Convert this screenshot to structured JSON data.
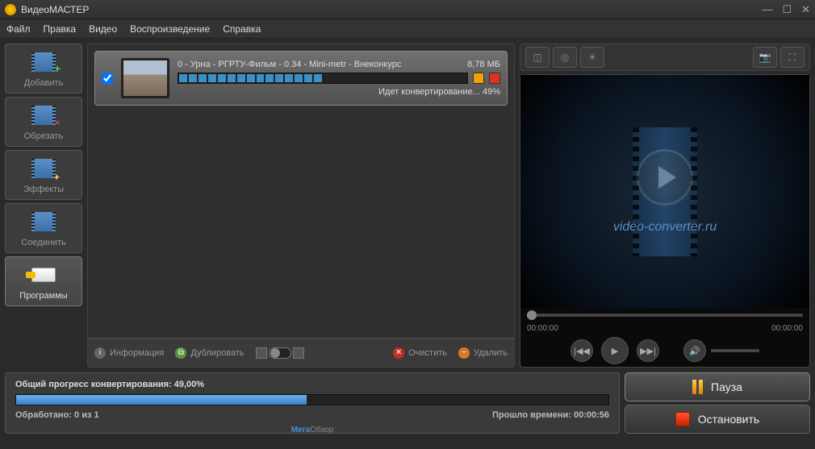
{
  "app_title": "ВидеоМАСТЕР",
  "menu": {
    "file": "Файл",
    "edit": "Правка",
    "video": "Видео",
    "playback": "Воспроизведение",
    "help": "Справка"
  },
  "sidebar": {
    "add": "Добавить",
    "cut": "Обрезать",
    "effects": "Эффекты",
    "join": "Соединить",
    "programs": "Программы"
  },
  "file": {
    "name": "0 - Урна - РГРТУ-Фильм - 0.34 - Mini-metr - Внеконкурс",
    "size": "8,78 МБ",
    "status": "Идет конвертирование... 49%"
  },
  "center_toolbar": {
    "info": "Информация",
    "duplicate": "Дублировать",
    "clear": "Очистить",
    "delete": "Удалить"
  },
  "preview": {
    "watermark": "video-converter.ru",
    "time_start": "00:00:00",
    "time_end": "00:00:00"
  },
  "progress": {
    "label": "Общий прогресс конвертирования: 49,00%",
    "processed_label": "Обработано: 0 из 1",
    "elapsed_label": "Прошло времени: 00:00:56"
  },
  "actions": {
    "pause": "Пауза",
    "stop": "Остановить"
  },
  "brand": {
    "prefix": "Мега",
    "suffix": "Обзор"
  }
}
